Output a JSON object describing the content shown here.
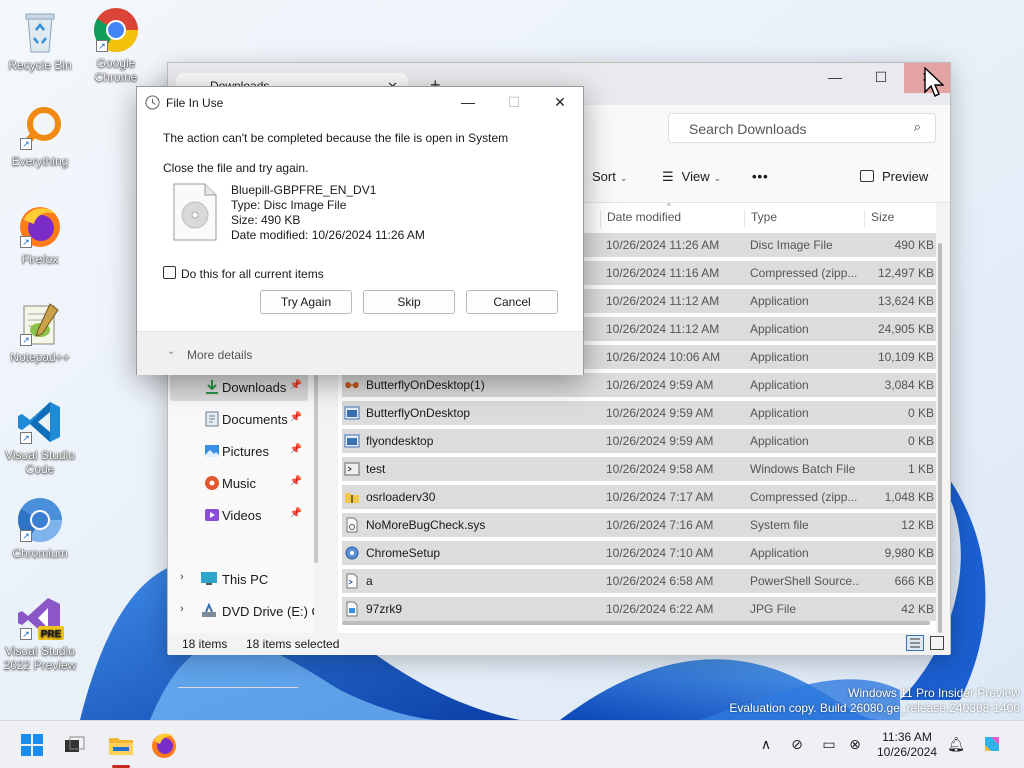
{
  "desktop": {
    "icons": [
      {
        "label": "Recycle Bin"
      },
      {
        "label": "Google Chrome"
      },
      {
        "label": "Everything"
      },
      {
        "label": "Firefox"
      },
      {
        "label": "Notepad++"
      },
      {
        "label": "Visual Studio Code"
      },
      {
        "label": "Chromium"
      },
      {
        "label": "Visual Studio 2022 Preview"
      }
    ],
    "watermark_line1": "Windows 11 Pro Insider Preview",
    "watermark_line2": "Evaluation copy. Build 26080.ge_release.240308-1400"
  },
  "explorer": {
    "tab_title": "Downloads",
    "tab_close": "✕",
    "new_tab": "+",
    "minimize": "—",
    "maximize": "☐",
    "close": "✕",
    "search_placeholder": "Search Downloads",
    "toolbar": {
      "sort_label": "Sort",
      "view_label": "View",
      "more_label": "•••",
      "preview_label": "Preview"
    },
    "nav": {
      "quick_access": [
        {
          "label": "Downloads"
        },
        {
          "label": "Documents"
        },
        {
          "label": "Pictures"
        },
        {
          "label": "Music"
        },
        {
          "label": "Videos"
        }
      ],
      "tree": [
        {
          "label": "This PC"
        },
        {
          "label": "DVD Drive (E:) G"
        }
      ]
    },
    "columns": {
      "date_modified": "Date modified",
      "type": "Type",
      "size": "Size"
    },
    "files": [
      {
        "name": "",
        "date": "10/26/2024 11:26 AM",
        "type": "Disc Image File",
        "size": "490 KB",
        "icon": "none"
      },
      {
        "name": "",
        "date": "10/26/2024 11:16 AM",
        "type": "Compressed (zipp...",
        "size": "12,497 KB",
        "icon": "none"
      },
      {
        "name": "",
        "date": "10/26/2024 11:12 AM",
        "type": "Application",
        "size": "13,624 KB",
        "icon": "none"
      },
      {
        "name": "",
        "date": "10/26/2024 11:12 AM",
        "type": "Application",
        "size": "24,905 KB",
        "icon": "none"
      },
      {
        "name": "",
        "date": "10/26/2024 10:06 AM",
        "type": "Application",
        "size": "10,109 KB",
        "icon": "none"
      },
      {
        "name": "ButterflyOnDesktop(1)",
        "date": "10/26/2024 9:59 AM",
        "type": "Application",
        "size": "3,084 KB",
        "icon": "butterfly-icon"
      },
      {
        "name": "ButterflyOnDesktop",
        "date": "10/26/2024 9:59 AM",
        "type": "Application",
        "size": "0 KB",
        "icon": "app-icon"
      },
      {
        "name": "flyondesktop",
        "date": "10/26/2024 9:59 AM",
        "type": "Application",
        "size": "0 KB",
        "icon": "app-icon"
      },
      {
        "name": "test",
        "date": "10/26/2024 9:58 AM",
        "type": "Windows Batch File",
        "size": "1 KB",
        "icon": "batch-icon"
      },
      {
        "name": "osrloaderv30",
        "date": "10/26/2024 7:17 AM",
        "type": "Compressed (zipp...",
        "size": "1,048 KB",
        "icon": "zip-icon"
      },
      {
        "name": "NoMoreBugCheck.sys",
        "date": "10/26/2024 7:16 AM",
        "type": "System file",
        "size": "12 KB",
        "icon": "sys-file-icon"
      },
      {
        "name": "ChromeSetup",
        "date": "10/26/2024 7:10 AM",
        "type": "Application",
        "size": "9,980 KB",
        "icon": "setup-icon"
      },
      {
        "name": "a",
        "date": "10/26/2024 6:58 AM",
        "type": "PowerShell Source...",
        "size": "666 KB",
        "icon": "powershell-icon"
      },
      {
        "name": "97zrk9",
        "date": "10/26/2024 6:22 AM",
        "type": "JPG File",
        "size": "42 KB",
        "icon": "image-icon"
      }
    ],
    "status": {
      "items": "18 items",
      "selected": "18 items selected"
    }
  },
  "dialog": {
    "title": "File In Use",
    "minimize": "—",
    "maximize": "☐",
    "close": "✕",
    "message": "The action can't be completed because the file is open in System",
    "instruction": "Close the file and try again.",
    "file_name": "Bluepill-GBPFRE_EN_DV1",
    "file_type": "Type: Disc Image File",
    "file_size": "Size: 490 KB",
    "file_date": "Date modified: 10/26/2024 11:26 AM",
    "checkbox_label": "Do this for all current items",
    "checkbox_checked": false,
    "try_again": "Try Again",
    "skip": "Skip",
    "cancel": "Cancel",
    "more_details": "More details"
  },
  "taskbar": {
    "time": "11:36 AM",
    "date": "10/26/2024",
    "chevron": "∧"
  },
  "colors": {
    "accent": "#005fb8",
    "close_hover": "#e4a3a3",
    "selection": "#dcdcdc"
  }
}
